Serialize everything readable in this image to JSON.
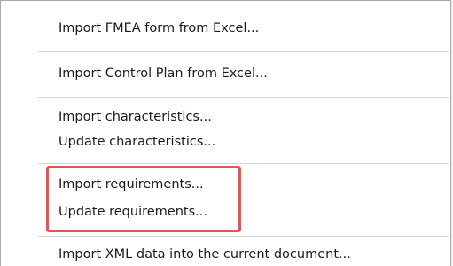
{
  "menu": {
    "items": [
      {
        "label": "Import FMEA form from Excel..."
      },
      {
        "label": "Import Control Plan from Excel..."
      },
      {
        "label": "Import characteristics..."
      },
      {
        "label": "Update characteristics..."
      },
      {
        "label": "Import requirements..."
      },
      {
        "label": "Update requirements..."
      },
      {
        "label": "Import XML data into the current document..."
      }
    ]
  },
  "highlight": {
    "color": "#e05555",
    "covers": [
      "Import requirements...",
      "Update requirements..."
    ]
  }
}
